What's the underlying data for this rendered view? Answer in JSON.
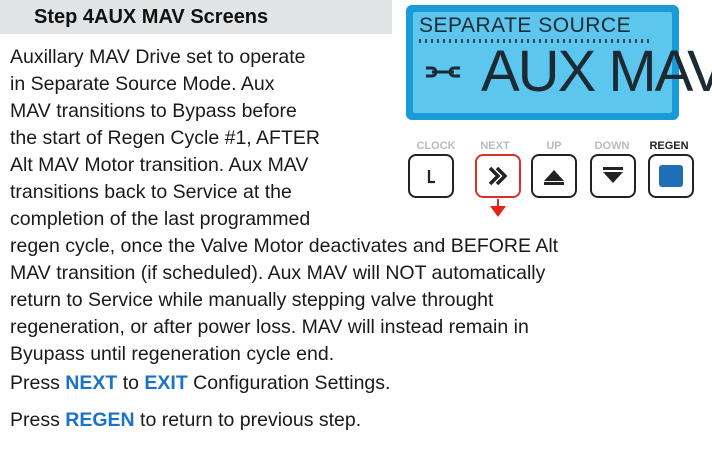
{
  "header": {
    "title": "Step 4AUX MAV Screens"
  },
  "paragraph_top": [
    "Auxillary MAV Drive set to operate",
    "in Separate Source Mode. Aux",
    "MAV transitions to Bypass before",
    "the start of Regen Cycle #1, AFTER",
    "Alt MAV Motor transition. Aux MAV",
    "transitions back to Service at the",
    "completion of the last programmed"
  ],
  "paragraph_bottom": [
    "regen cycle, once the Valve Motor deactivates and BEFORE Alt",
    "MAV transition (if scheduled). Aux MAV will NOT automatically",
    "return to Service while manually stepping valve throught",
    "regeneration, or after power loss. MAV will instead remain in",
    "Byupass until regeneration cycle end."
  ],
  "instructions": [
    {
      "pre": "Press ",
      "kw1": "NEXT",
      "mid": " to ",
      "kw2": "EXIT",
      "post": " Configuration Settings."
    },
    {
      "pre": "Press ",
      "kw1": "REGEN",
      "mid": " to return to previous step.",
      "kw2": "",
      "post": ""
    }
  ],
  "lcd": {
    "top_text": "SEPARATE SOURCE",
    "main_text": "AUX MAV",
    "icon": "wrench-icon"
  },
  "buttons": [
    {
      "label": "CLOCK",
      "icon": "clock-icon",
      "active": false
    },
    {
      "label": "NEXT",
      "icon": "double-chevron-right-icon",
      "active": true,
      "highlight": true
    },
    {
      "label": "UP",
      "icon": "triangle-up-icon",
      "active": false
    },
    {
      "label": "DOWN",
      "icon": "triangle-down-icon",
      "active": false
    },
    {
      "label": "REGEN",
      "icon": "regen-square-icon",
      "active": true
    }
  ],
  "colors": {
    "keyword": "#1a73c8",
    "lcd_frame": "#1a9bd7",
    "lcd_screen": "#5cc6ee",
    "highlight": "#d9302a",
    "regen": "#1f6fb5"
  }
}
